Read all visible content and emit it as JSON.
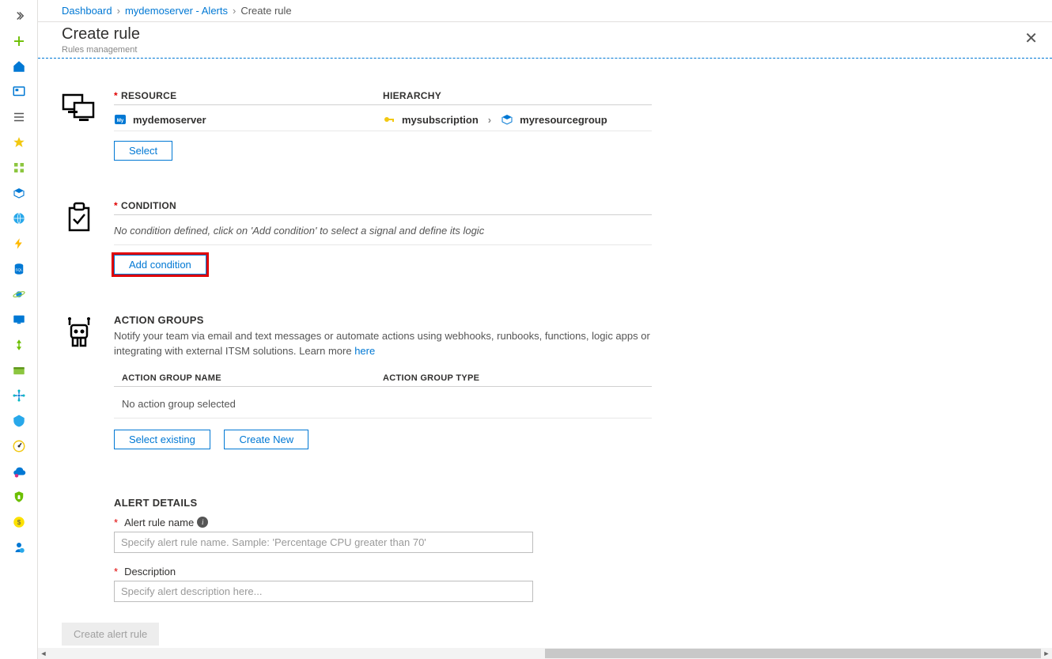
{
  "breadcrumb": {
    "dashboard": "Dashboard",
    "server_alerts": "mydemoserver - Alerts",
    "current": "Create rule"
  },
  "blade": {
    "title": "Create rule",
    "subtitle": "Rules management"
  },
  "resource": {
    "header": "RESOURCE",
    "hierarchy_header": "HIERARCHY",
    "name": "mydemoserver",
    "subscription": "mysubscription",
    "resource_group": "myresourcegroup",
    "select_btn": "Select"
  },
  "condition": {
    "header": "CONDITION",
    "empty_text": "No condition defined, click on 'Add condition' to select a signal and define its logic",
    "add_btn": "Add condition"
  },
  "action_groups": {
    "header": "ACTION GROUPS",
    "desc_pre": "Notify your team via email and text messages or automate actions using webhooks, runbooks, functions, logic apps or integrating with external ITSM solutions. Learn more ",
    "desc_link": "here",
    "col_name": "ACTION GROUP NAME",
    "col_type": "ACTION GROUP TYPE",
    "empty": "No action group selected",
    "select_existing_btn": "Select existing",
    "create_new_btn": "Create New"
  },
  "details": {
    "header": "ALERT DETAILS",
    "name_label": "Alert rule name",
    "name_placeholder": "Specify alert rule name. Sample: 'Percentage CPU greater than 70'",
    "desc_label": "Description",
    "desc_placeholder": "Specify alert description here..."
  },
  "footer": {
    "create_btn": "Create alert rule"
  }
}
